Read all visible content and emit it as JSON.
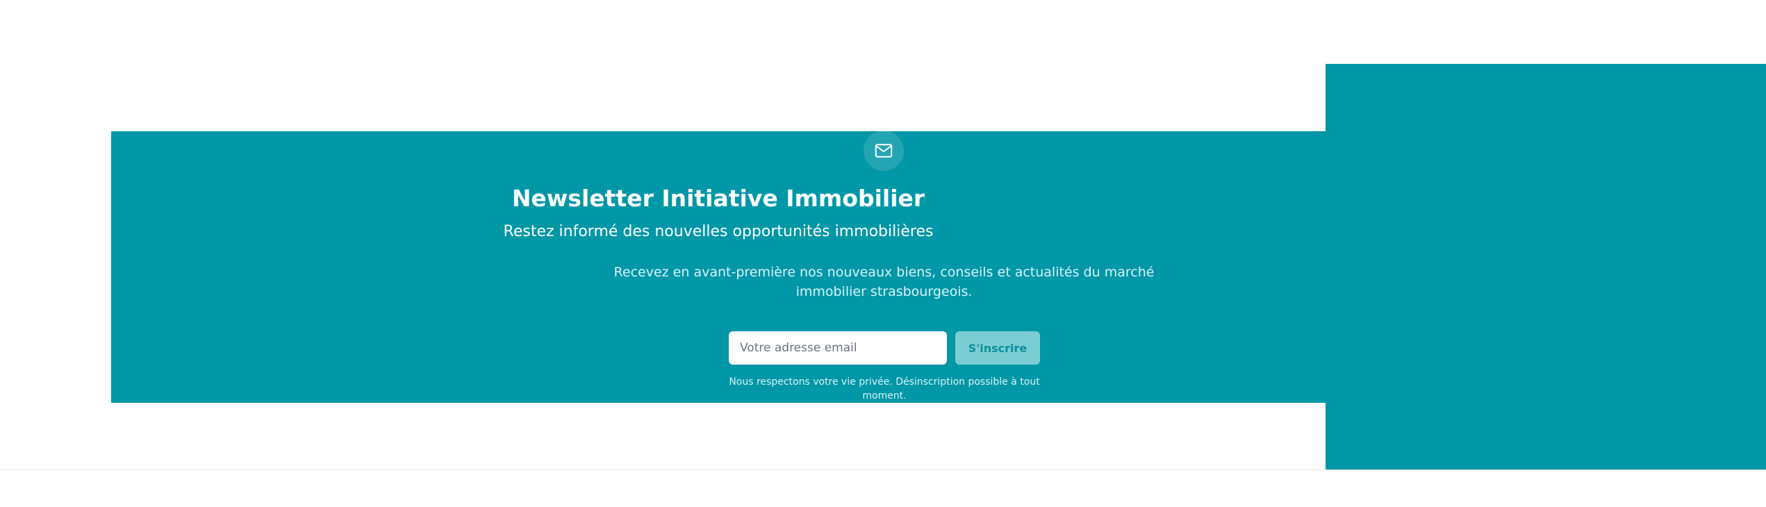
{
  "newsletter": {
    "icon": "mail-icon",
    "title": "Newsletter Initiative Immobilier",
    "subtitle": "Restez informé des nouvelles opportunités immobilières",
    "description": "Recevez en avant-première nos nouveaux biens, conseils et actualités du marché immobilier strasbourgeois.",
    "email_placeholder": "Votre adresse email",
    "submit_label": "S'inscrire",
    "privacy_note": "Nous respectons votre vie privée. Désinscription possible à tout moment."
  },
  "colors": {
    "brand_teal": "#0097a7",
    "button_background": "#7ccdd3",
    "button_text": "#08909c",
    "input_background": "#ffffff",
    "page_background": "#ffffff"
  }
}
